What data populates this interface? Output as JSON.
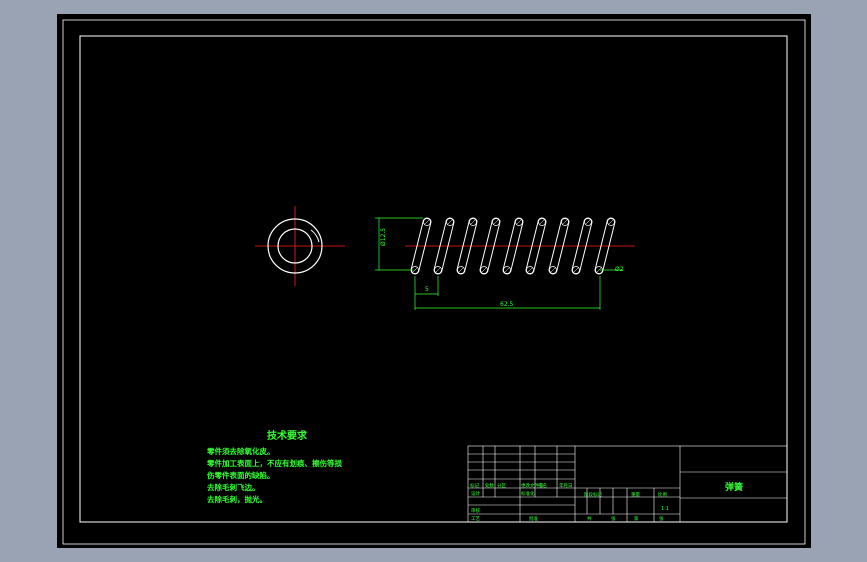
{
  "colors": {
    "background": "#9aa3b4",
    "sheet": "#000000",
    "border": "#ffffff",
    "dimension": "#33ff33",
    "centerline": "#ff2222",
    "outline": "#ffffff"
  },
  "dimensions": {
    "outer_diameter": "Ø12.5",
    "wire_diameter": "Ø2",
    "pitch": "5",
    "length": "62.5"
  },
  "technical_requirements": {
    "title": "技术要求",
    "lines": [
      "零件须去除氧化皮。",
      "零件加工表面上，不应有划痕、擦伤等损",
      "伤零件表面的缺陷。",
      "去除毛刺飞边。",
      "去除毛刺，抛光。"
    ]
  },
  "title_block": {
    "part_name": "弹簧",
    "labels": {
      "mark": "标记",
      "count": "处数",
      "zone": "分区",
      "change_doc": "更改文件号",
      "signature": "签名",
      "date": "年月日",
      "design": "设计",
      "standardization": "标准化",
      "stage_mark": "阶段标记",
      "weight": "重量",
      "scale": "比例",
      "review": "审核",
      "process": "工艺",
      "approve": "批准",
      "sheets_total": "共",
      "sheet": "张",
      "page": "第",
      "scale_value": "1:1"
    }
  }
}
